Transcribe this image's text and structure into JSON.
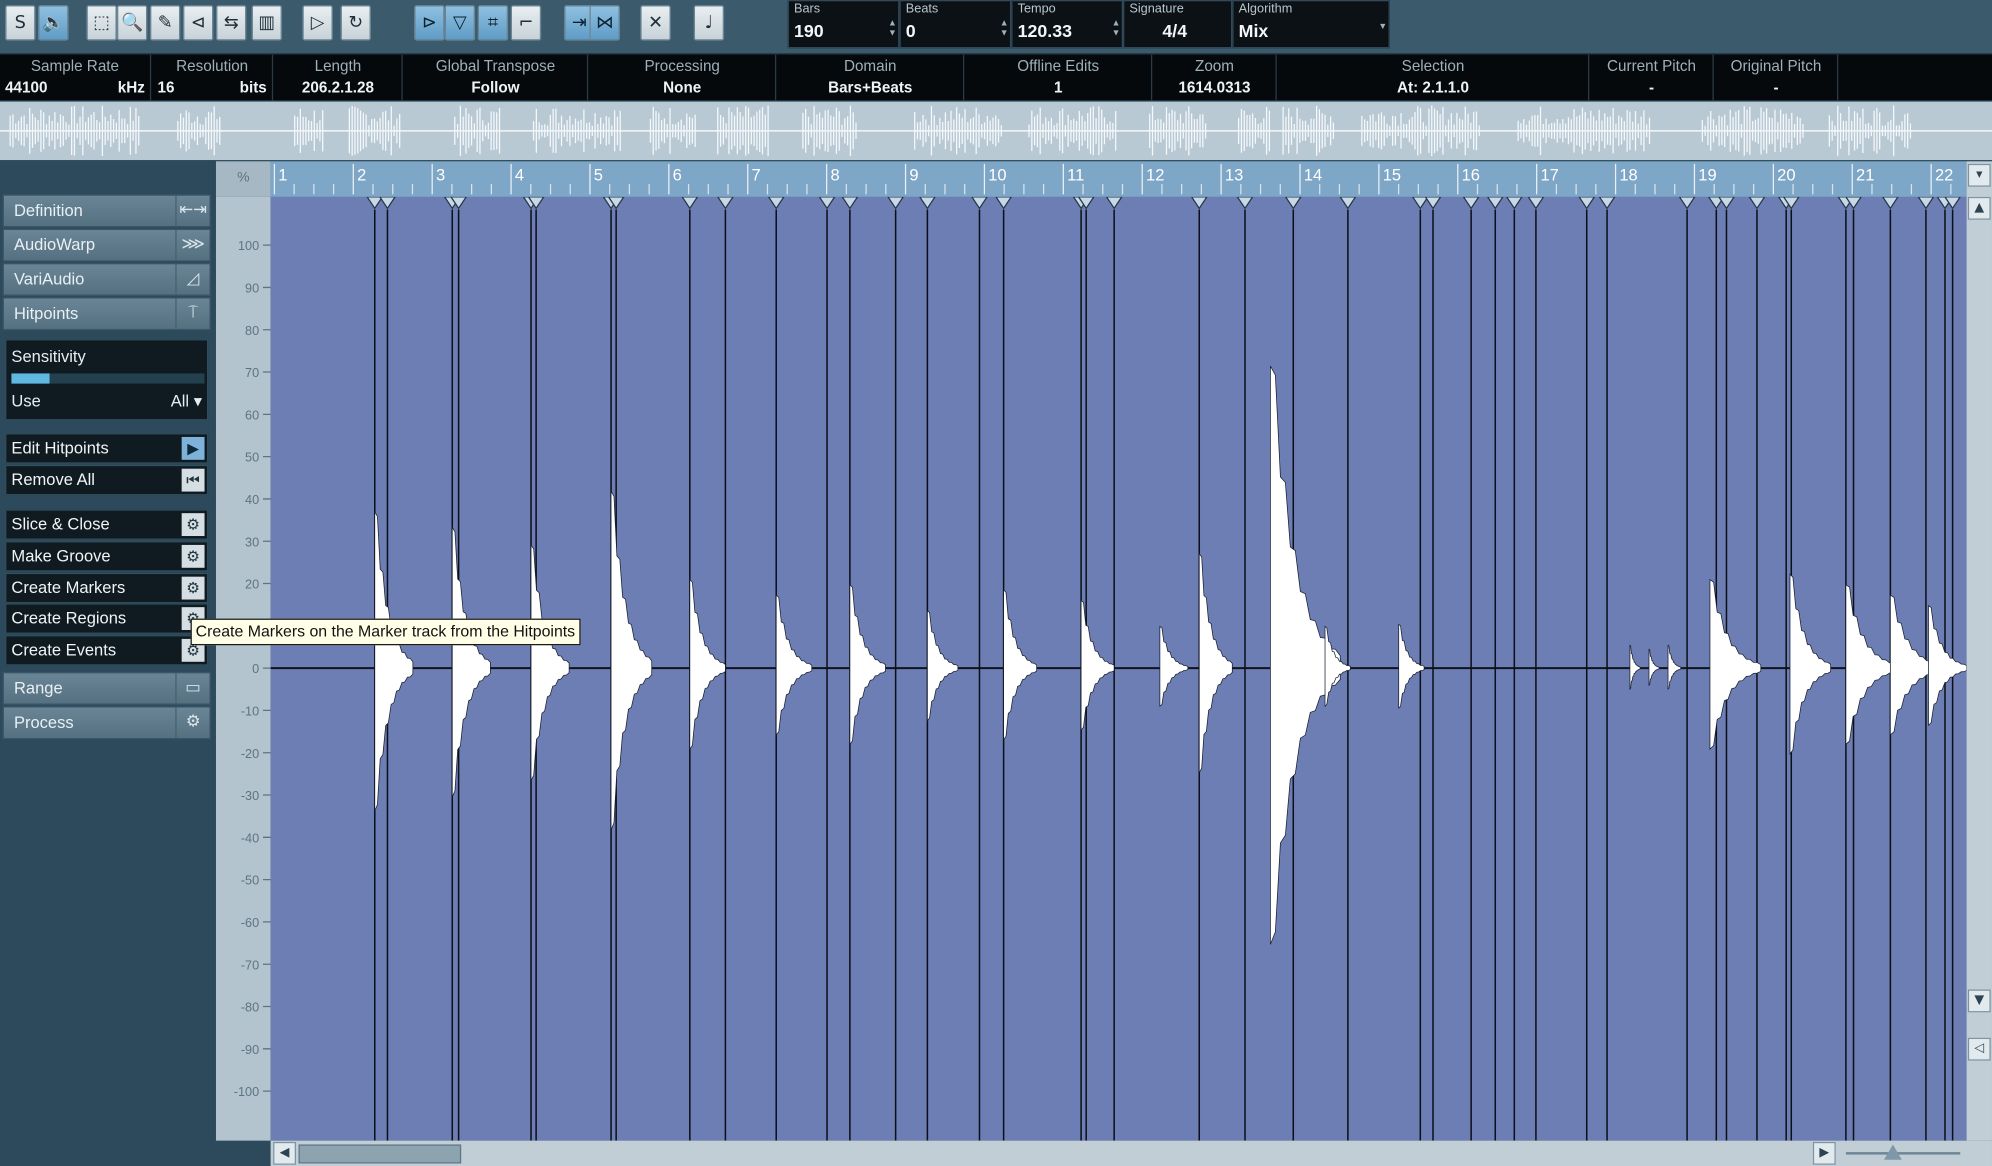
{
  "toolbar": {
    "buttons": [
      {
        "name": "solo-icon",
        "glyph": "S"
      },
      {
        "name": "speaker-icon",
        "glyph": "🔈"
      },
      {
        "name": "select-range-icon",
        "glyph": "⬚"
      },
      {
        "name": "zoom-icon",
        "glyph": "🔍"
      },
      {
        "name": "pencil-icon",
        "glyph": "✎"
      },
      {
        "name": "audition-icon",
        "glyph": "⊲"
      },
      {
        "name": "scrub-icon",
        "glyph": "⇆"
      },
      {
        "name": "sliced-view-icon",
        "glyph": "▥"
      },
      {
        "name": "play-icon",
        "glyph": "▷"
      },
      {
        "name": "loop-icon",
        "glyph": "↻"
      },
      {
        "name": "snap-hitpoints-icon",
        "glyph": "⊳"
      },
      {
        "name": "marker-down-icon",
        "glyph": "▽"
      },
      {
        "name": "grid-icon",
        "glyph": "⌗"
      },
      {
        "name": "bracket-icon",
        "glyph": "⌐"
      },
      {
        "name": "warp-tabs-icon",
        "glyph": "⇥"
      },
      {
        "name": "split-icon",
        "glyph": "⋈"
      },
      {
        "name": "free-warp-icon",
        "glyph": "✕"
      },
      {
        "name": "note-icon",
        "glyph": "♩"
      }
    ],
    "fields": {
      "bars_label": "Bars",
      "bars_value": "190",
      "beats_label": "Beats",
      "beats_value": "0",
      "tempo_label": "Tempo",
      "tempo_value": "120.33",
      "signature_label": "Signature",
      "signature_value": "4/4",
      "algorithm_label": "Algorithm",
      "algorithm_value": "Mix"
    }
  },
  "infoline": {
    "sample_rate": {
      "label": "Sample Rate",
      "value": "44100",
      "unit": "kHz"
    },
    "resolution": {
      "label": "Resolution",
      "value": "16",
      "unit": "bits"
    },
    "length": {
      "label": "Length",
      "value": "206.2.1.28"
    },
    "global_transpose": {
      "label": "Global Transpose",
      "value": "Follow"
    },
    "processing": {
      "label": "Processing",
      "value": "None"
    },
    "domain": {
      "label": "Domain",
      "value": "Bars+Beats"
    },
    "offline_edits": {
      "label": "Offline Edits",
      "value": "1"
    },
    "zoom": {
      "label": "Zoom",
      "value": "1614.0313"
    },
    "selection": {
      "label": "Selection",
      "value": "At: 2.1.1.0"
    },
    "current_pitch": {
      "label": "Current Pitch",
      "value": "-"
    },
    "original_pitch": {
      "label": "Original Pitch",
      "value": "-"
    }
  },
  "inspector": {
    "sections": {
      "definition": "Definition",
      "audiowarp": "AudioWarp",
      "variaudio": "VariAudio",
      "hitpoints": "Hitpoints",
      "range": "Range",
      "process": "Process"
    },
    "sensitivity_label": "Sensitivity",
    "sensitivity_value": 0.2,
    "use_label": "Use",
    "use_value": "All",
    "buttons": {
      "edit_hitpoints": "Edit Hitpoints",
      "remove_all": "Remove All",
      "slice_close": "Slice & Close",
      "make_groove": "Make Groove",
      "create_markers": "Create Markers",
      "create_regions": "Create Regions",
      "create_events": "Create Events"
    }
  },
  "corner_label": "%",
  "ruler_bars": [
    "1",
    "2",
    "3",
    "4",
    "5",
    "6",
    "7",
    "8",
    "9",
    "10",
    "11",
    "12",
    "13",
    "14",
    "15",
    "16",
    "17",
    "18",
    "19",
    "20",
    "21",
    "22"
  ],
  "amplitude_ticks": [
    "100",
    "90",
    "80",
    "70",
    "60",
    "50",
    "40",
    "30",
    "20",
    "10",
    "0",
    "-10",
    "-20",
    "-30",
    "-40",
    "-50",
    "-60",
    "-70",
    "-80",
    "-90",
    "-100"
  ],
  "tooltip": "Create Markers on the Marker track from the Hitpoints",
  "colors": {
    "waveform_bg": "#6d7eb4",
    "ruler": "#7ea6c6",
    "overview": "#b9c9d4"
  }
}
